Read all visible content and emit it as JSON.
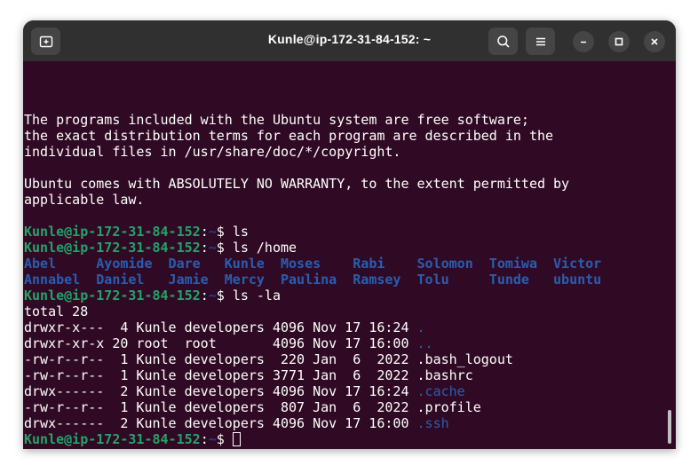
{
  "window": {
    "title": "Kunle@ip-172-31-84-152: ~"
  },
  "icons": {
    "new_tab": "new-tab-icon",
    "search": "search-icon",
    "menu": "hamburger-menu-icon",
    "minimize": "minimize-icon",
    "maximize": "maximize-icon",
    "close": "close-icon"
  },
  "colors": {
    "terminal_bg": "#300a24",
    "titlebar_bg": "#303030",
    "prompt_user": "#26a269",
    "prompt_path": "#12488b",
    "directory": "#2a5db0",
    "text": "#ffffff"
  },
  "prompt": {
    "user_host": "Kunle@ip-172-31-84-152",
    "colon": ":",
    "path": "~",
    "symbol": "$ "
  },
  "motd": [
    "The programs included with the Ubuntu system are free software;",
    "the exact distribution terms for each program are described in the",
    "individual files in /usr/share/doc/*/copyright.",
    "",
    "Ubuntu comes with ABSOLUTELY NO WARRANTY, to the extent permitted by",
    "applicable law."
  ],
  "commands": {
    "cmd1": "ls",
    "cmd2": "ls /home",
    "cmd3": "ls -la"
  },
  "home_listing": [
    "Abel     Ayomide  Dare   Kunle  Moses    Rabi    Solomon  Tomiwa  Victor",
    "Annabel  Daniel   Jamie  Mercy  Paulina  Ramsey  Tolu     Tunde   ubuntu"
  ],
  "total_line": "total 28",
  "la_listing": [
    {
      "meta": "drwxr-x---  4 Kunle developers 4096 Nov 17 16:24 ",
      "name": ".",
      "is_dir": true
    },
    {
      "meta": "drwxr-xr-x 20 root  root       4096 Nov 17 16:00 ",
      "name": "..",
      "is_dir": true
    },
    {
      "meta": "-rw-r--r--  1 Kunle developers  220 Jan  6  2022 ",
      "name": ".bash_logout",
      "is_dir": false
    },
    {
      "meta": "-rw-r--r--  1 Kunle developers 3771 Jan  6  2022 ",
      "name": ".bashrc",
      "is_dir": false
    },
    {
      "meta": "drwx------  2 Kunle developers 4096 Nov 17 16:24 ",
      "name": ".cache",
      "is_dir": true
    },
    {
      "meta": "-rw-r--r--  1 Kunle developers  807 Jan  6  2022 ",
      "name": ".profile",
      "is_dir": false
    },
    {
      "meta": "drwx------  2 Kunle developers 4096 Nov 17 16:00 ",
      "name": ".ssh",
      "is_dir": true
    }
  ]
}
